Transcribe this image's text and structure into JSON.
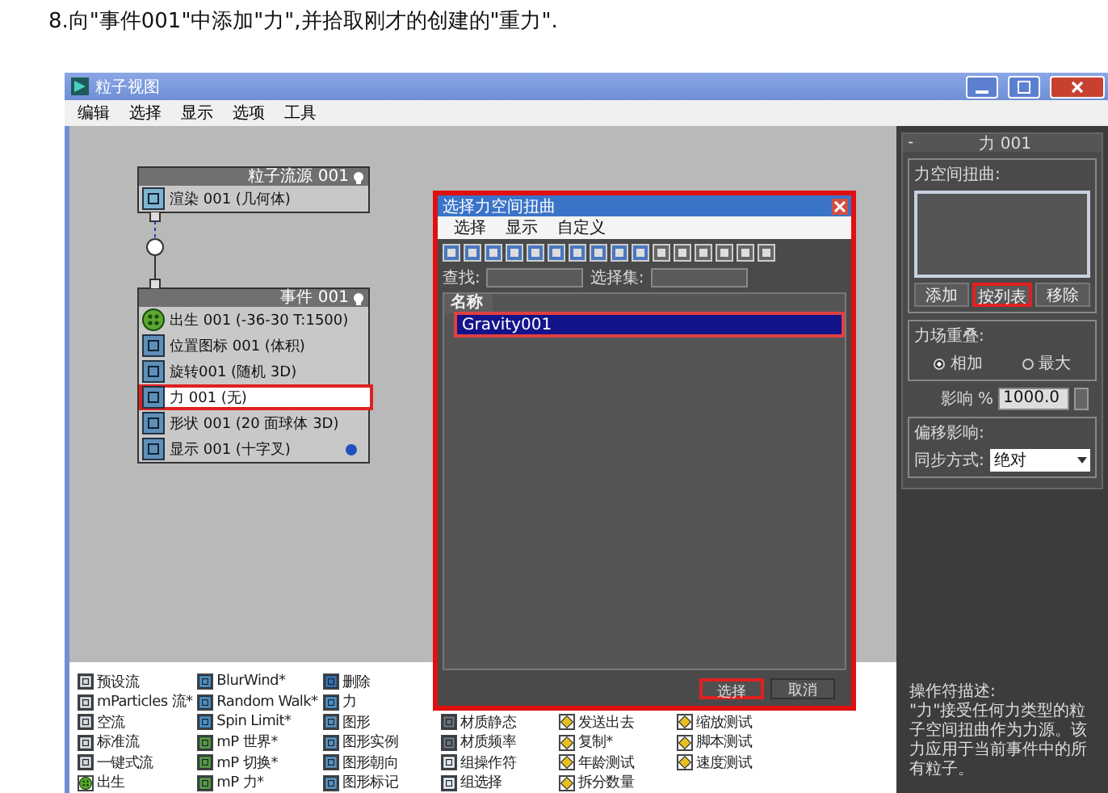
{
  "instruction": "8.向\"事件001\"中添加\"力\",并拾取刚才的创建的\"重力\".",
  "window": {
    "title": "粒子视图"
  },
  "menu": [
    "编辑",
    "选择",
    "显示",
    "选项",
    "工具"
  ],
  "nodes": [
    {
      "title": "粒子流源 001",
      "items": [
        {
          "kind": "render",
          "label": "渲染 001 (几何体)",
          "highlighted": false
        }
      ]
    },
    {
      "title": "事件 001",
      "items": [
        {
          "kind": "birth",
          "label": "出生 001 (-36-30 T:1500)",
          "highlighted": false
        },
        {
          "kind": "position",
          "label": "位置图标 001 (体积)",
          "highlighted": false
        },
        {
          "kind": "spin",
          "label": "旋转001 (随机 3D)",
          "highlighted": false
        },
        {
          "kind": "force",
          "label": "力 001 (无)",
          "highlighted": true
        },
        {
          "kind": "shape",
          "label": "形状 001 (20 面球体 3D)",
          "highlighted": false
        },
        {
          "kind": "display",
          "label": "显示 001 (十字叉)",
          "highlighted": false
        }
      ]
    }
  ],
  "dialog": {
    "title": "选择力空间扭曲",
    "menu": [
      "选择",
      "显示",
      "自定义"
    ],
    "find_label": "查找:",
    "set_label": "选择集:",
    "column": "名称",
    "rows": [
      {
        "label": "Gravity001",
        "selected": true
      }
    ],
    "buttons": [
      {
        "label": "选择",
        "highlighted": true
      },
      {
        "label": "取消",
        "highlighted": false
      }
    ]
  },
  "panel": {
    "collapse": "-",
    "rollout": "力 001",
    "forces_title": "力空间扭曲:",
    "buttons": [
      {
        "label": "添加",
        "highlighted": false
      },
      {
        "label": "按列表",
        "highlighted": true
      },
      {
        "label": "移除",
        "highlighted": false
      }
    ],
    "overlap_title": "力场重叠:",
    "overlap_options": [
      {
        "label": "相加",
        "selected": true
      },
      {
        "label": "最大",
        "selected": false
      }
    ],
    "influence_label": "影响 %",
    "influence_value": "1000.0",
    "offset_title": "偏移影响:",
    "sync_label": "同步方式:",
    "sync_value": "绝对",
    "description_title": "操作符描述:",
    "description": "\"力\"接受任何力类型的粒子空间扭曲作为力源。该力应用于当前事件中的所有粒子。"
  },
  "depot": [
    [
      {
        "kind": "flow",
        "label": "预设流"
      },
      {
        "kind": "flow",
        "label": "mParticles 流*"
      },
      {
        "kind": "flow",
        "label": "空流"
      },
      {
        "kind": "flow",
        "label": "标准流"
      },
      {
        "kind": "flow",
        "label": "一键式流"
      },
      {
        "kind": "birth",
        "label": "出生"
      }
    ],
    [
      {
        "kind": "operator",
        "label": "BlurWind*"
      },
      {
        "kind": "operator",
        "label": "Random Walk*"
      },
      {
        "kind": "operator",
        "label": "Spin Limit*"
      },
      {
        "kind": "mp",
        "label": "mP 世界*"
      },
      {
        "kind": "mp",
        "label": "mP 切换*"
      },
      {
        "kind": "mp",
        "label": "mP 力*"
      }
    ],
    [
      {
        "kind": "delete",
        "label": "删除"
      },
      {
        "kind": "operator",
        "label": "力"
      },
      {
        "kind": "shape",
        "label": "图形"
      },
      {
        "kind": "shape",
        "label": "图形实例"
      },
      {
        "kind": "shape",
        "label": "图形朝向"
      },
      {
        "kind": "shape",
        "label": "图形标记"
      }
    ],
    [
      {
        "kind": "material",
        "label": "材质静态"
      },
      {
        "kind": "material",
        "label": "材质频率"
      },
      {
        "kind": "group",
        "label": "组操作符"
      },
      {
        "kind": "group",
        "label": "组选择"
      }
    ],
    [
      {
        "kind": "test",
        "label": "发送出去"
      },
      {
        "kind": "test",
        "label": "复制*"
      },
      {
        "kind": "test",
        "label": "年龄测试"
      },
      {
        "kind": "test",
        "label": "拆分数量"
      }
    ],
    [
      {
        "kind": "test",
        "label": "缩放测试"
      },
      {
        "kind": "script",
        "label": "脚本测试"
      },
      {
        "kind": "test",
        "label": "速度测试"
      }
    ]
  ]
}
